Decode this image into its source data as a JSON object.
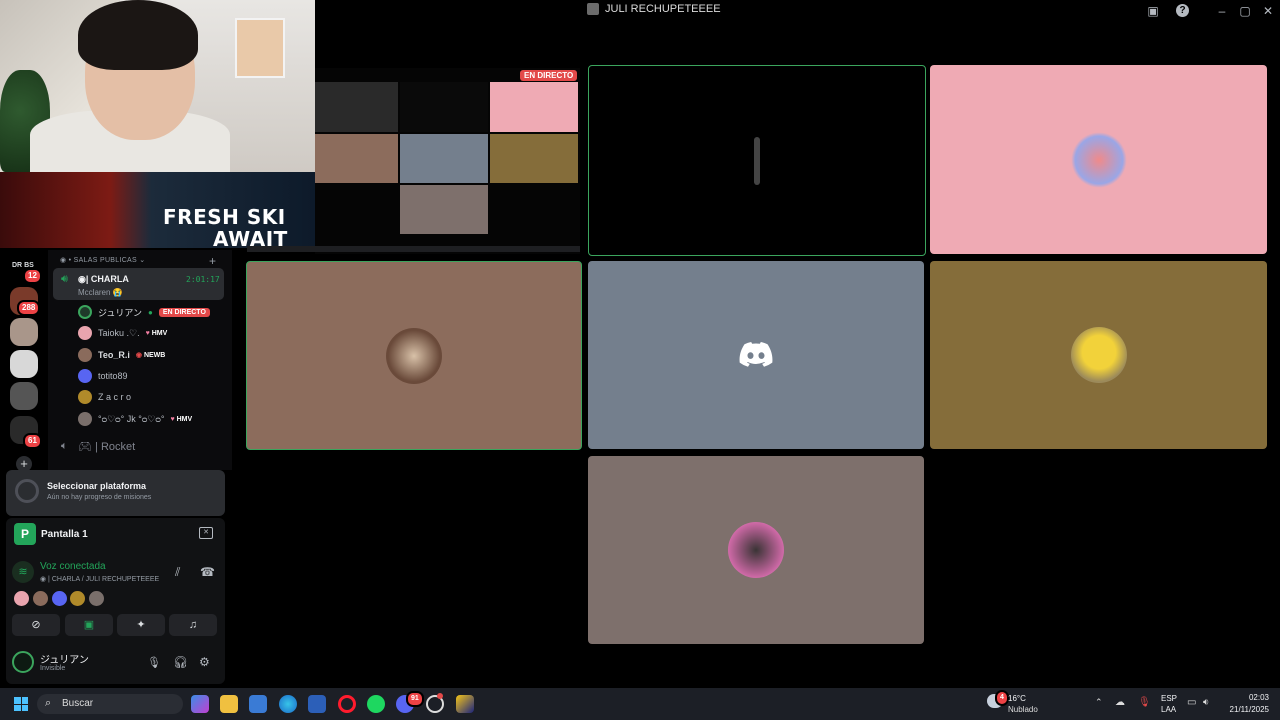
{
  "window": {
    "title": "JULI RECHUPETEEEE"
  },
  "stream_overlay": {
    "promo_line1": "FRESH SKI",
    "promo_line2": "AWAIT",
    "live_badge": "EN DIRECTO"
  },
  "servers": {
    "top_label_a": "DR",
    "top_label_b": "BS",
    "top_badge": "12",
    "badges": [
      "288",
      "61"
    ]
  },
  "channels": {
    "category": "SALAS PUBLICAS",
    "voice_channel": {
      "name": "CHARLA",
      "timer": "2:01:17",
      "activity": "Mcclaren 😭"
    },
    "members": [
      {
        "name": "ジュリアン",
        "tag": "EN DIRECTO",
        "live": true,
        "color": "#1f3a2a"
      },
      {
        "name": "Taioku .♡.",
        "tag": "HMV",
        "color": "#e9a4ae"
      },
      {
        "name": "Teo_R.i",
        "tag": "NEWB",
        "color": "#8a6b5c"
      },
      {
        "name": "totito89",
        "tag": "",
        "color": "#5865f2"
      },
      {
        "name": "Z a c r o",
        "tag": "",
        "color": "#b08a2a"
      },
      {
        "name": "°ᴑ♡ᴑ° Jk °ᴑ♡ᴑ°",
        "tag": "HMV",
        "color": "#7a6f6b"
      }
    ],
    "next_channel": "Rocket"
  },
  "quest": {
    "title": "Seleccionar plataforma",
    "subtitle": "Aún no hay progreso de misiones"
  },
  "stream_panel": {
    "screen_label": "Pantalla 1",
    "voice_status": "Voz conectada",
    "voice_location": "CHARLA / JULI RECHUPETEEEE",
    "voice_avatar_colors": [
      "#e9a4ae",
      "#8a6b5c",
      "#5865f2",
      "#b08a2a",
      "#7a6f6b"
    ]
  },
  "user": {
    "name": "ジュリアン",
    "status": "Invisible"
  },
  "tiles": [
    {
      "name": "tile-dark",
      "bg": "#000000",
      "border": "#3ba55d"
    },
    {
      "name": "tile-pink",
      "bg": "#efaab4",
      "border": ""
    },
    {
      "name": "tile-brown",
      "bg": "#8c6c5c",
      "border": "#3ba55d"
    },
    {
      "name": "tile-discord",
      "bg": "#747f8d",
      "border": ""
    },
    {
      "name": "tile-olive",
      "bg": "#856d3a",
      "border": ""
    },
    {
      "name": "tile-taupe",
      "bg": "#7e706c",
      "border": ""
    }
  ],
  "taskbar": {
    "search_placeholder": "Buscar",
    "weather_temp": "16°C",
    "weather_desc": "Nublado",
    "weather_alert": "4",
    "lang_line1": "ESP",
    "lang_line2": "LAA",
    "time": "02:03",
    "date": "21/11/2025",
    "discord_badge": "91"
  }
}
